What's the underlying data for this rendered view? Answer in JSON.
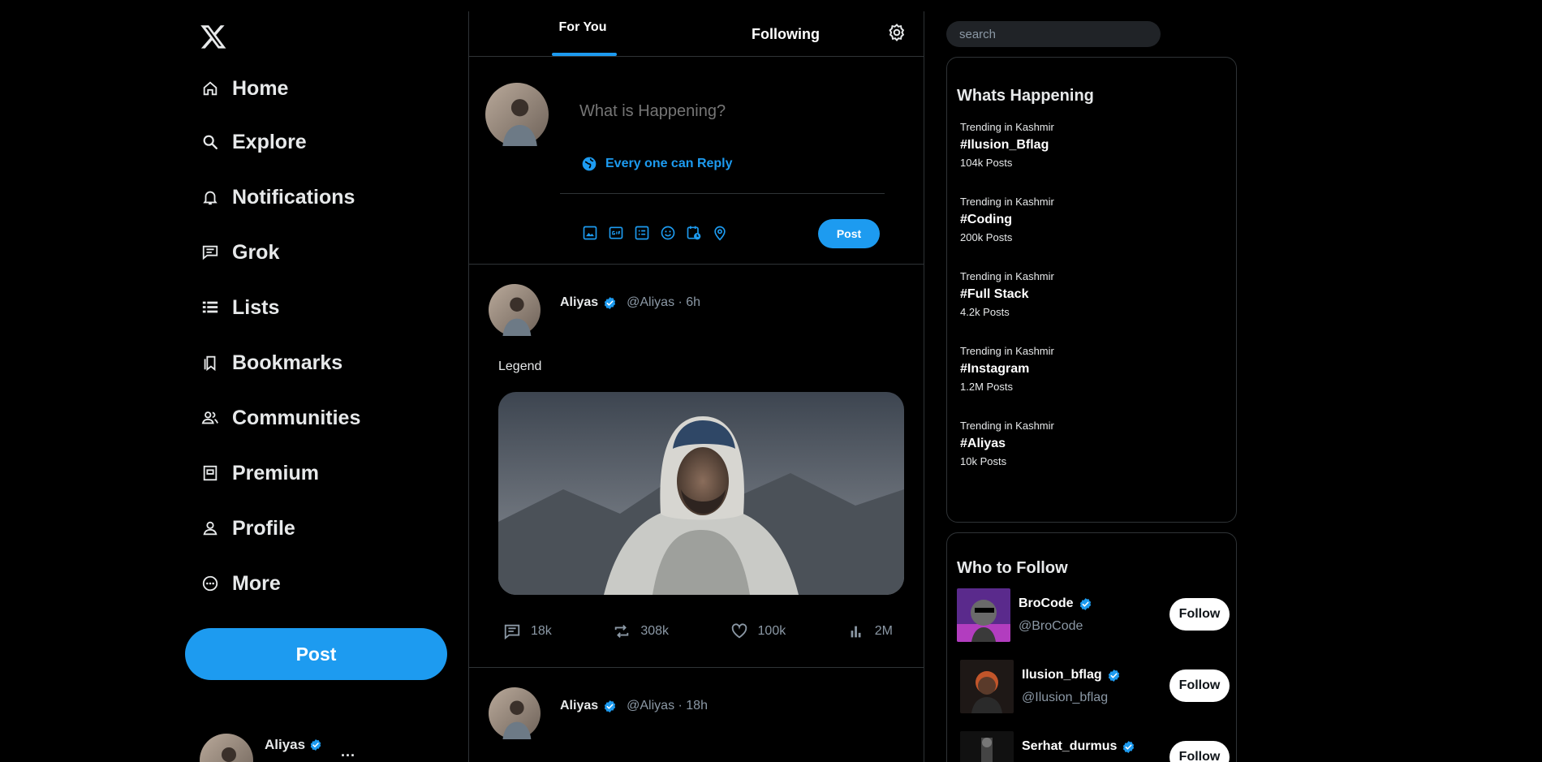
{
  "nav": {
    "items": [
      {
        "label": "Home",
        "icon": "home-icon"
      },
      {
        "label": "Explore",
        "icon": "search-icon"
      },
      {
        "label": "Notifications",
        "icon": "bell-icon"
      },
      {
        "label": "Grok",
        "icon": "grok-icon"
      },
      {
        "label": "Lists",
        "icon": "list-icon"
      },
      {
        "label": "Bookmarks",
        "icon": "bookmark-icon"
      },
      {
        "label": "Communities",
        "icon": "communities-icon"
      },
      {
        "label": "Premium",
        "icon": "premium-icon"
      },
      {
        "label": "Profile",
        "icon": "profile-icon"
      },
      {
        "label": "More",
        "icon": "more-icon"
      }
    ],
    "post_label": "Post"
  },
  "account": {
    "name": "Aliyas",
    "more": "..."
  },
  "tabs": {
    "for_you": "For You",
    "following": "Following"
  },
  "composer": {
    "placeholder": "What is Happening?",
    "reply_setting": "Every one can Reply",
    "post_label": "Post"
  },
  "tweets": [
    {
      "name": "Aliyas",
      "handle": "@Aliyas · 6h",
      "text": "Legend",
      "replies": "18k",
      "reposts": "308k",
      "likes": "100k",
      "views": "2M"
    },
    {
      "name": "Aliyas",
      "handle": "@Aliyas · 18h"
    }
  ],
  "search": {
    "placeholder": "search"
  },
  "trends": {
    "title": "Whats Happening",
    "items": [
      {
        "context": "Trending in Kashmir",
        "tag": "#Ilusion_Bflag",
        "count": "104k Posts"
      },
      {
        "context": "Trending in Kashmir",
        "tag": "#Coding",
        "count": "200k Posts"
      },
      {
        "context": "Trending in Kashmir",
        "tag": "#Full Stack",
        "count": "4.2k Posts"
      },
      {
        "context": "Trending in Kashmir",
        "tag": "#Instagram",
        "count": "1.2M Posts"
      },
      {
        "context": "Trending in Kashmir",
        "tag": "#Aliyas",
        "count": "10k Posts"
      }
    ]
  },
  "who_to_follow": {
    "title": "Who to Follow",
    "follow_label": "Follow",
    "items": [
      {
        "name": "BroCode",
        "handle": "@BroCode"
      },
      {
        "name": "Ilusion_bflag",
        "handle": "@Ilusion_bflag"
      },
      {
        "name": "Serhat_durmus",
        "handle": ""
      }
    ]
  },
  "colors": {
    "accent": "#1d9bf0",
    "background": "#000000",
    "border": "#2f3336",
    "muted": "#8b98a5"
  }
}
